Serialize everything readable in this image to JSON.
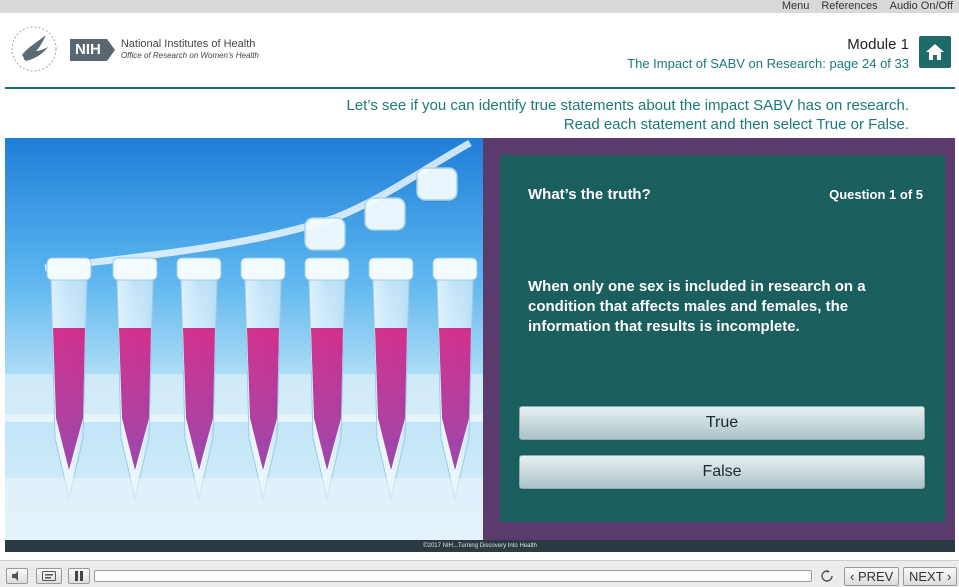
{
  "top_menu": {
    "menu": "Menu",
    "references": "References",
    "audio": "Audio On/Off"
  },
  "header": {
    "nih_badge": "NIH",
    "org_name": "National Institutes of Health",
    "office_name": "Office of Research on Women's Health",
    "module": "Module 1",
    "page_info": "The Impact of SABV on Research: page 24 of 33"
  },
  "instructions": {
    "line1": "Let’s see if you can identify true statements about the impact SABV has on research.",
    "line2": "Read each statement and then select True or False."
  },
  "quiz": {
    "heading": "What’s the truth?",
    "counter": "Question 1  of 5",
    "statement": "When only one sex is included in research on a condition that affects males and females, the information that results is incomplete.",
    "true_label": "True",
    "false_label": "False"
  },
  "image_caption": "©2017 NIH...Turning Discovery Into Health",
  "player": {
    "prev_label": "‹ PREV",
    "next_label": "NEXT ›",
    "progress_percent": 0
  },
  "colors": {
    "teal_panel": "#1b5e5e",
    "purple_frame": "#5b3a6e",
    "teal_text": "#1b7a7a"
  },
  "icons": [
    "hhs-eagle-icon",
    "home-icon",
    "volume-icon",
    "captions-icon",
    "pause-icon",
    "replay-icon"
  ]
}
